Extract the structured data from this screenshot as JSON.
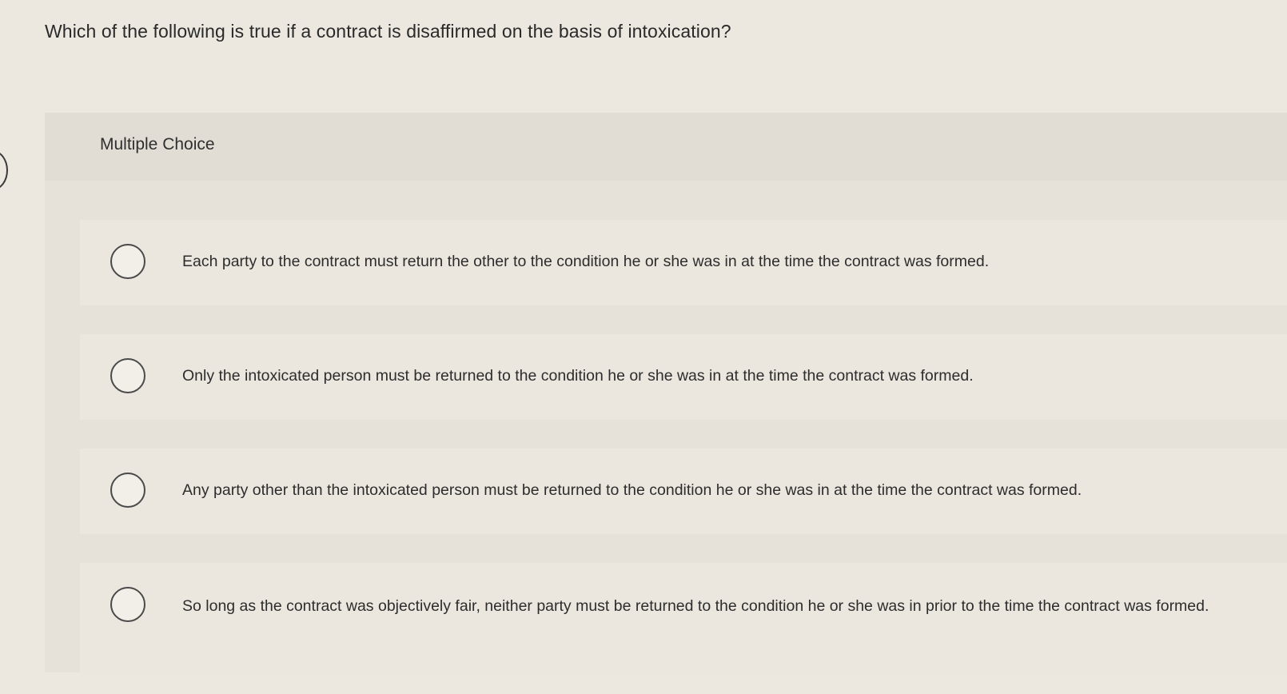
{
  "question": {
    "text": "Which of the following is true if a contract is disaffirmed on the basis of intoxication?"
  },
  "panel": {
    "label": "Multiple Choice"
  },
  "options": [
    {
      "label": "Each party to the contract must return the other to the condition he or she was in at the time the contract was formed.",
      "selected": false
    },
    {
      "label": "Only the intoxicated person must be returned to the condition he or she was in at the time the contract was formed.",
      "selected": false
    },
    {
      "label": "Any party other than the intoxicated person must be returned to the condition he or she was in at the time the contract was formed.",
      "selected": false
    },
    {
      "label": "So long as the contract was objectively fair, neither party must be returned to the condition he or she was in prior to the time the contract was formed.",
      "selected": false
    }
  ],
  "colors": {
    "background": "#ece7df",
    "panel": "#e6e1d9",
    "radio_border": "#4a4a4a"
  }
}
